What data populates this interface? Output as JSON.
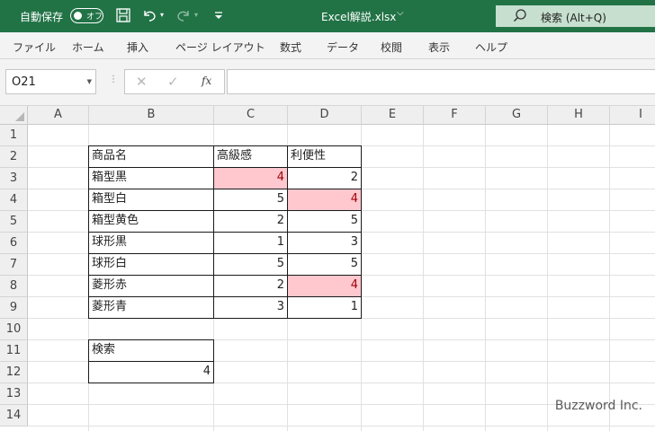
{
  "titlebar": {
    "autosave_label": "自動保存",
    "toggle_label": "オフ",
    "doc_title": "Excel解説.xlsx",
    "search_placeholder": "検索 (Alt+Q)"
  },
  "icons": {
    "save": "save-icon",
    "undo": "undo-icon",
    "redo": "redo-icon",
    "customize": "customize-qat-icon",
    "search": "search-icon"
  },
  "ribbon_tabs": [
    "ファイル",
    "ホーム",
    "挿入",
    "ページ レイアウト",
    "数式",
    "データ",
    "校閲",
    "表示",
    "ヘルプ"
  ],
  "formula_bar": {
    "name_box": "O21",
    "cancel": "✕",
    "enter": "✓",
    "fx": "fx",
    "formula": ""
  },
  "columns": [
    "A",
    "B",
    "C",
    "D",
    "E",
    "F",
    "G",
    "H",
    "I"
  ],
  "rows": [
    "1",
    "2",
    "3",
    "4",
    "5",
    "6",
    "7",
    "8",
    "9",
    "10",
    "11",
    "12",
    "13",
    "14"
  ],
  "table": {
    "headers": [
      "商品名",
      "高級感",
      "利便性"
    ],
    "rows": [
      {
        "name": "箱型黒",
        "c": "4",
        "d": "2"
      },
      {
        "name": "箱型白",
        "c": "5",
        "d": "4"
      },
      {
        "name": "箱型黄色",
        "c": "2",
        "d": "5"
      },
      {
        "name": "球形黒",
        "c": "1",
        "d": "3"
      },
      {
        "name": "球形白",
        "c": "5",
        "d": "5"
      },
      {
        "name": "菱形赤",
        "c": "2",
        "d": "4"
      },
      {
        "name": "菱形青",
        "c": "3",
        "d": "1"
      }
    ],
    "highlight_color": "#ffc7ce",
    "highlight_text_color": "#9c0006"
  },
  "search_box": {
    "label": "検索",
    "value": "4"
  },
  "watermark": "Buzzword Inc.",
  "colors": {
    "titlebar": "#217346",
    "search_bg": "#c6dfce"
  }
}
